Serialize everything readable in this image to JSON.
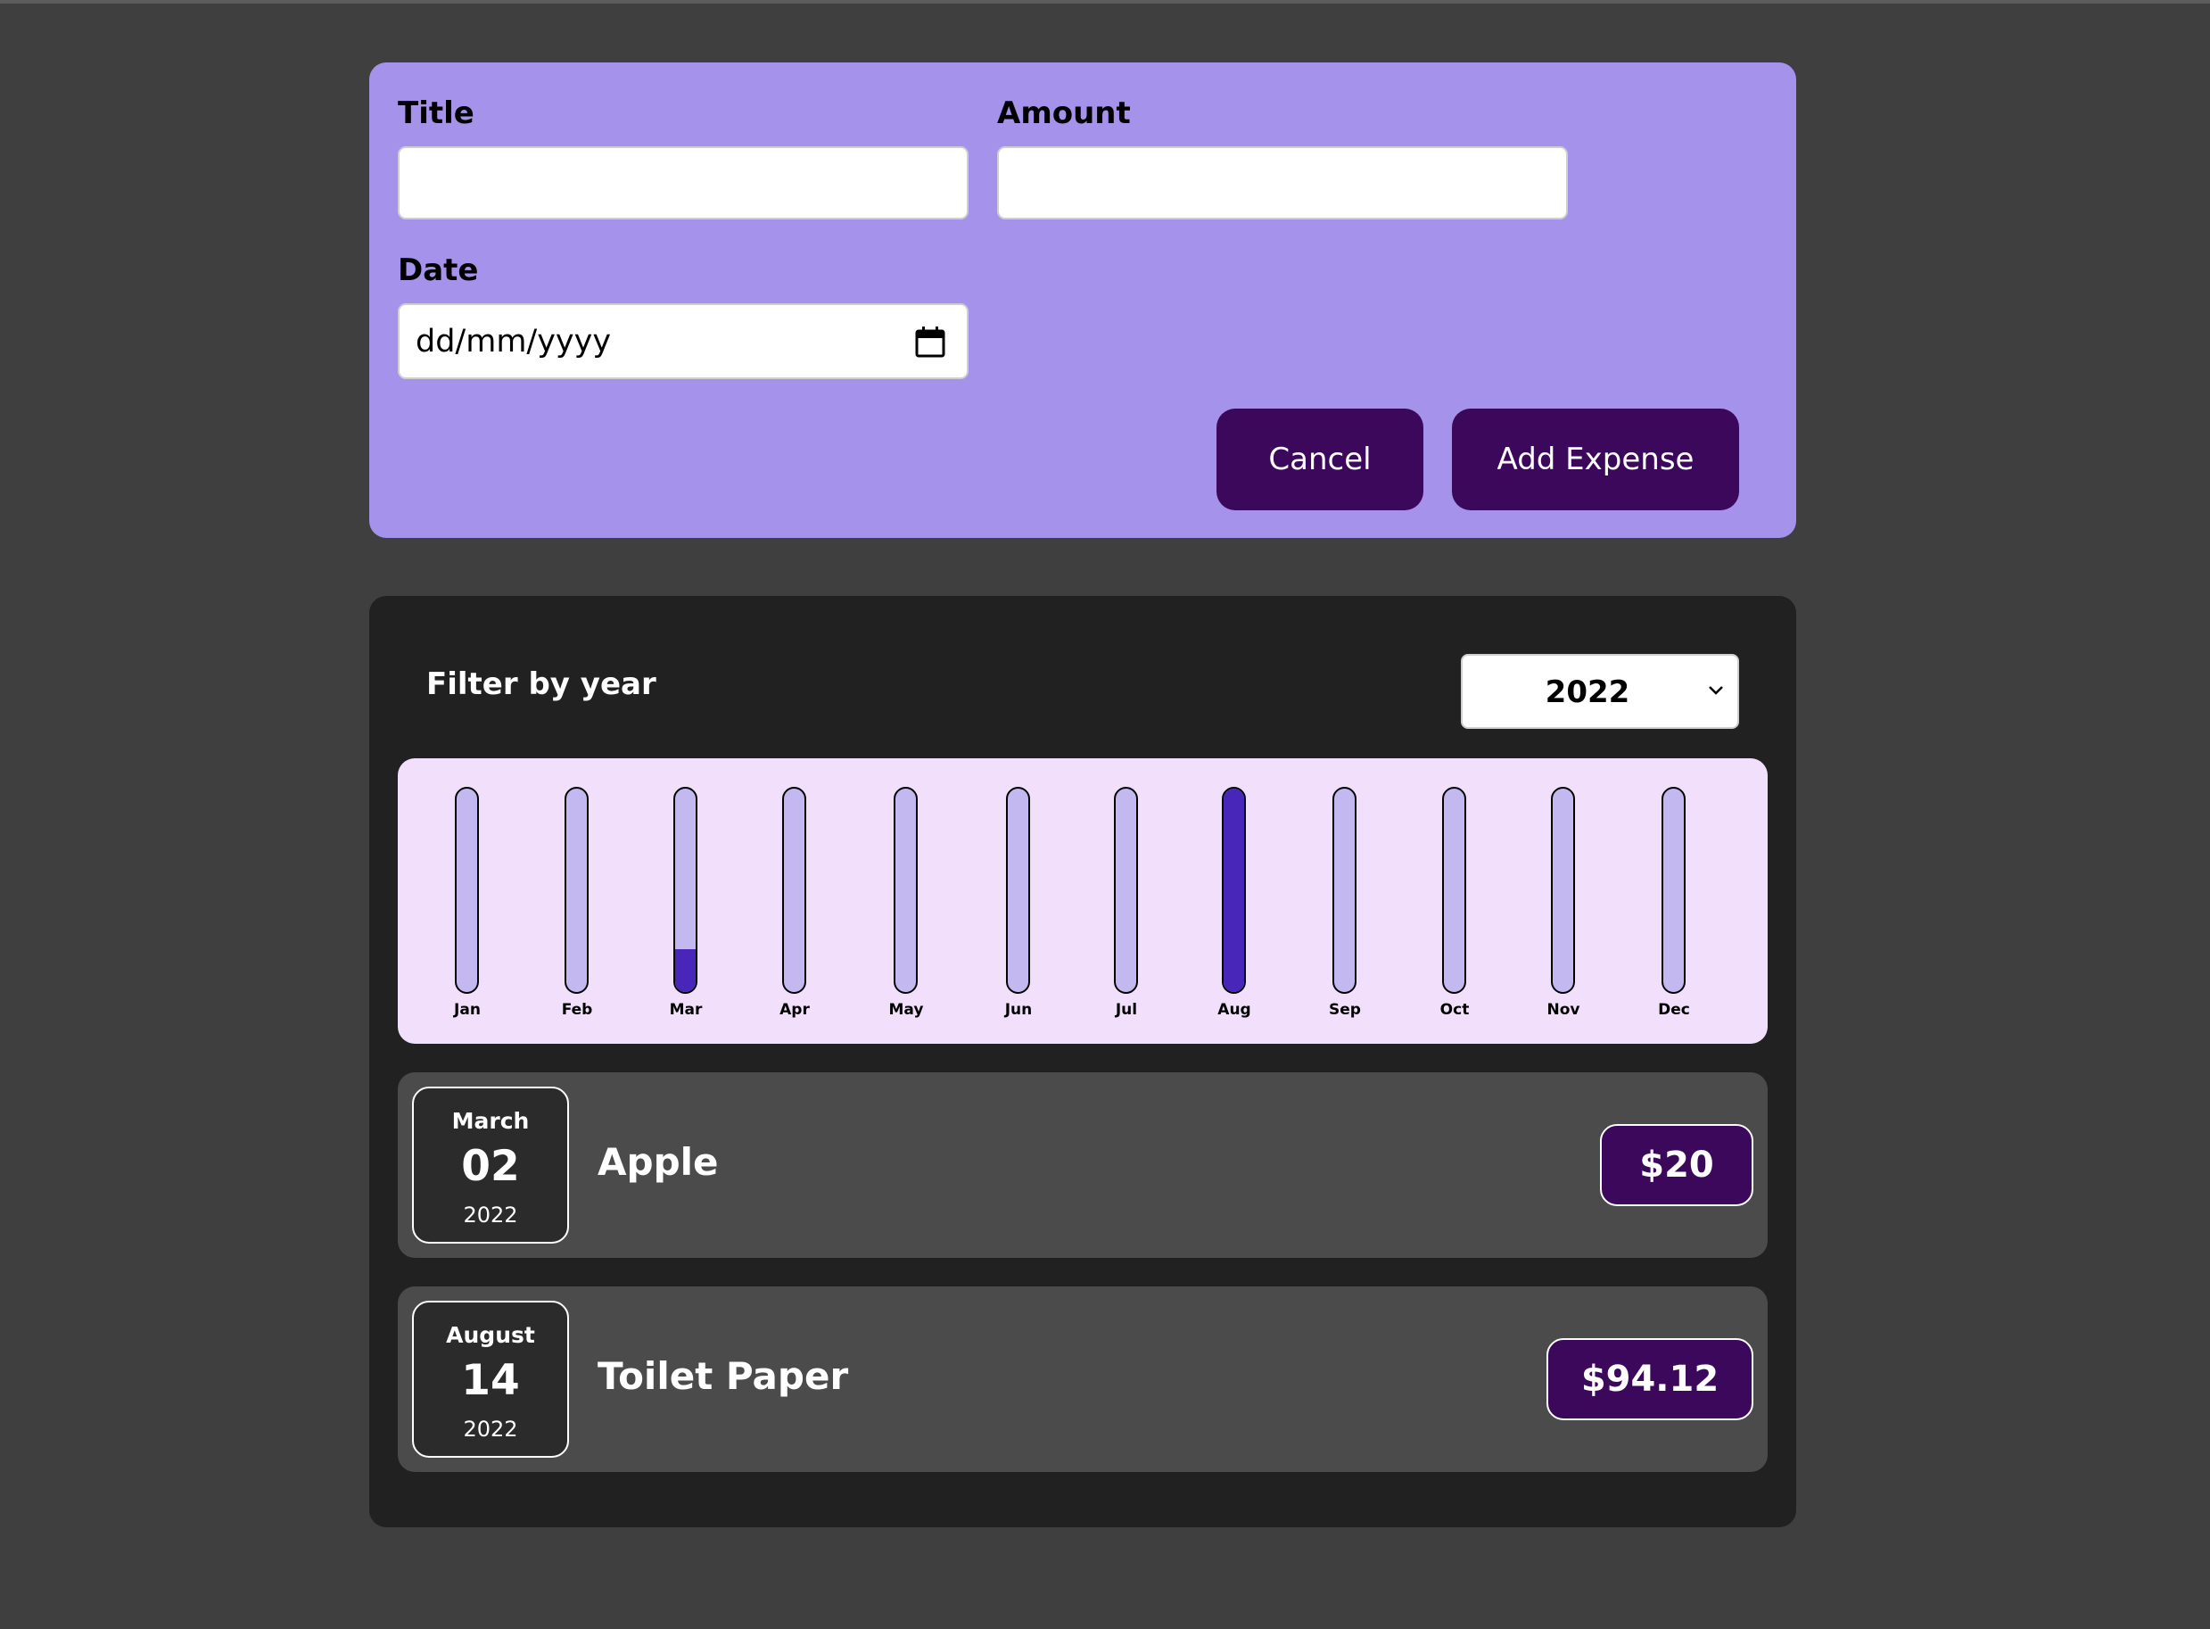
{
  "form": {
    "title_label": "Title",
    "title_value": "",
    "amount_label": "Amount",
    "amount_value": "",
    "date_label": "Date",
    "date_placeholder": "dd/mm/yyyy",
    "cancel_label": "Cancel",
    "submit_label": "Add Expense"
  },
  "filter": {
    "label": "Filter by year",
    "selected_year": "2022"
  },
  "chart_data": {
    "type": "bar",
    "categories": [
      "Jan",
      "Feb",
      "Mar",
      "Apr",
      "May",
      "Jun",
      "Jul",
      "Aug",
      "Sep",
      "Oct",
      "Nov",
      "Dec"
    ],
    "values": [
      0,
      0,
      20,
      0,
      0,
      0,
      0,
      94.12,
      0,
      0,
      0,
      0
    ],
    "ylim": [
      0,
      94.12
    ]
  },
  "expenses": [
    {
      "month": "March",
      "day": "02",
      "year": "2022",
      "title": "Apple",
      "amount": "$20"
    },
    {
      "month": "August",
      "day": "14",
      "year": "2022",
      "title": "Toilet Paper",
      "amount": "$94.12"
    }
  ],
  "colors": {
    "background": "#3f3f3f",
    "form_card": "#a592ea",
    "list_card": "#212121",
    "chart_panel": "#f2dffb",
    "bar_track": "#c3b8f0",
    "bar_fill": "#4826b9",
    "button": "#3c085c",
    "expense_item": "#4b4b4b"
  }
}
